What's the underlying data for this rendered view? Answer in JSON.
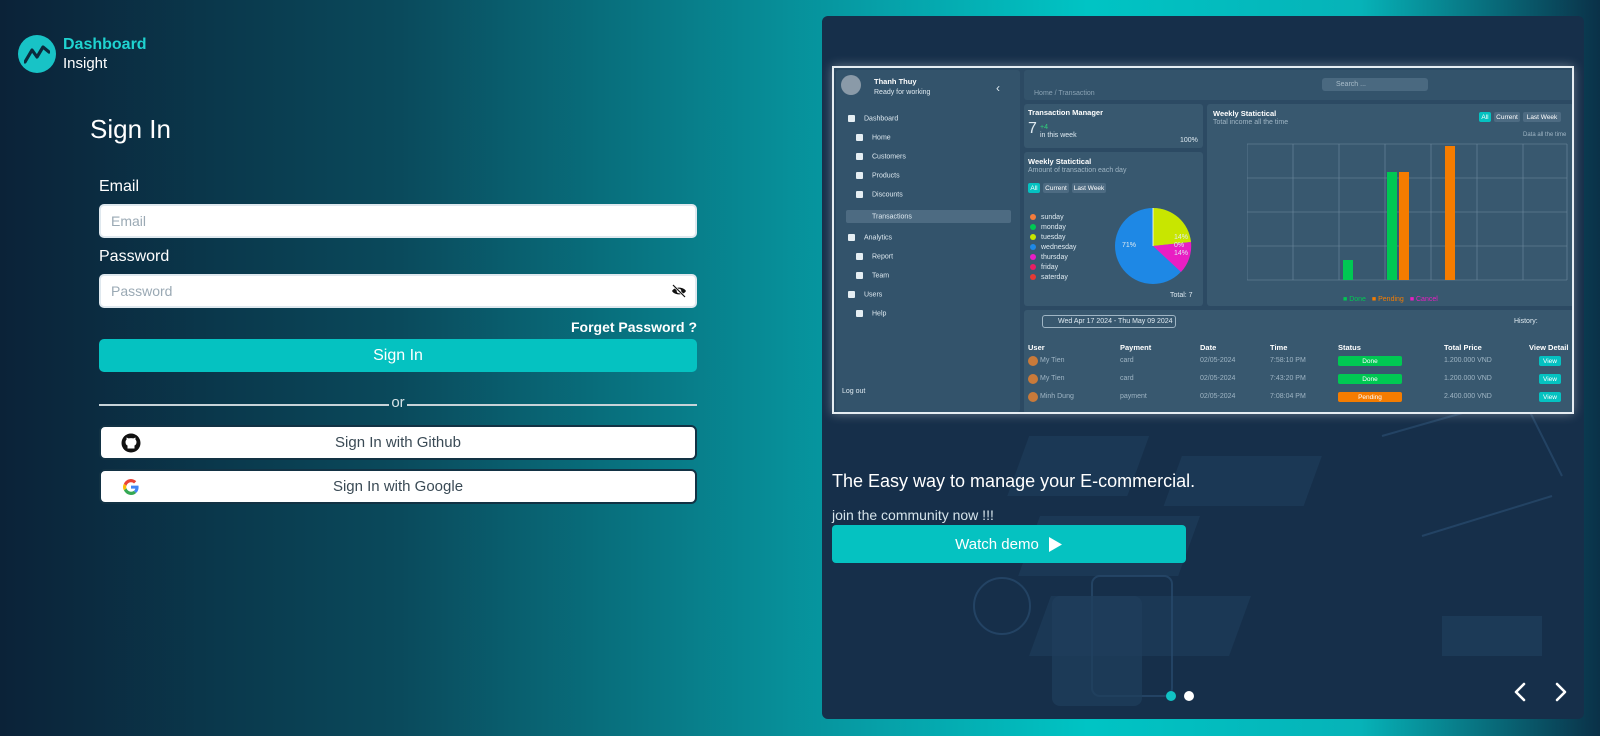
{
  "brand": {
    "line1": "Dashboard",
    "line2": "Insight"
  },
  "signin": {
    "title": "Sign In",
    "email_label": "Email",
    "email_placeholder": "Email",
    "password_label": "Password",
    "password_placeholder": "Password",
    "forget": "Forget Password ?",
    "button": "Sign In",
    "divider": "or",
    "github": "Sign In with Github",
    "google": "Sign In with Google"
  },
  "promo": {
    "headline": "The Easy way to manage your E-commercial.",
    "subtext": "join the community now !!!",
    "demo_button": "Watch demo",
    "slides": 2,
    "active_slide": 1
  },
  "preview": {
    "user_name": "Thanh Thuy",
    "user_status": "Ready for working",
    "breadcrumb": "Home  /  Transaction",
    "search_placeholder": "Search ...",
    "nav": {
      "dashboard": "Dashboard",
      "home": "Home",
      "customers": "Customers",
      "products": "Products",
      "discounts": "Discounts",
      "transactions": "Transactions",
      "analytics": "Analytics",
      "report": "Report",
      "team": "Team",
      "users": "Users",
      "help": "Help",
      "logout": "Log out"
    },
    "tm": {
      "title": "Transaction Manager",
      "count": "7",
      "delta": "+4",
      "period": "in this week",
      "pct": "100%"
    },
    "weekly": {
      "title": "Weekly Statictical",
      "subtitle": "Amount of transaction each day",
      "f_all": "All",
      "f_current": "Current",
      "f_last": "Last Week",
      "days": [
        "sunday",
        "monday",
        "tuesday",
        "wednesday",
        "thursday",
        "friday",
        "saterday"
      ],
      "day_colors": [
        "#f47c3c",
        "#00c853",
        "#c8e600",
        "#1e88e5",
        "#e91ec3",
        "#e91e63",
        "#e53935"
      ],
      "total": "Total: 7",
      "p1": "71%",
      "p2": "14%",
      "p3": "0%",
      "p4": "14%"
    },
    "bars": {
      "title": "Weekly Statictical",
      "subtitle": "Total income all the time",
      "f_all": "All",
      "f_current": "Current",
      "f_last": "Last Week",
      "note": "Data all the time",
      "legend_done": "Done",
      "legend_pending": "Pending",
      "legend_cancel": "Cancel"
    },
    "table": {
      "date_range": "Wed Apr 17 2024 - Thu May 09 2024",
      "history": "History:",
      "headers": [
        "User",
        "Payment",
        "Date",
        "Time",
        "Status",
        "Total Price",
        "View Detail"
      ],
      "rows": [
        {
          "user": "My Tien",
          "payment": "card",
          "date": "02/05-2024",
          "time": "7:58:10 PM",
          "status": "Done",
          "price": "1.200.000 VND",
          "view": "View"
        },
        {
          "user": "My Tien",
          "payment": "card",
          "date": "02/05-2024",
          "time": "7:43:20 PM",
          "status": "Done",
          "price": "1.200.000 VND",
          "view": "View"
        },
        {
          "user": "Minh Dung",
          "payment": "payment",
          "date": "02/05-2024",
          "time": "7:08:04 PM",
          "status": "Pending",
          "price": "2.400.000 VND",
          "view": "View"
        }
      ]
    }
  },
  "colors": {
    "accent": "#05c2c1",
    "done": "#00c853",
    "pending": "#f57c00",
    "cancel": "#e91ec3"
  },
  "icons": [
    "brand-logo-icon",
    "eye-off-icon",
    "github-icon",
    "google-icon",
    "play-icon",
    "chevron-left-icon",
    "chevron-right-icon"
  ]
}
